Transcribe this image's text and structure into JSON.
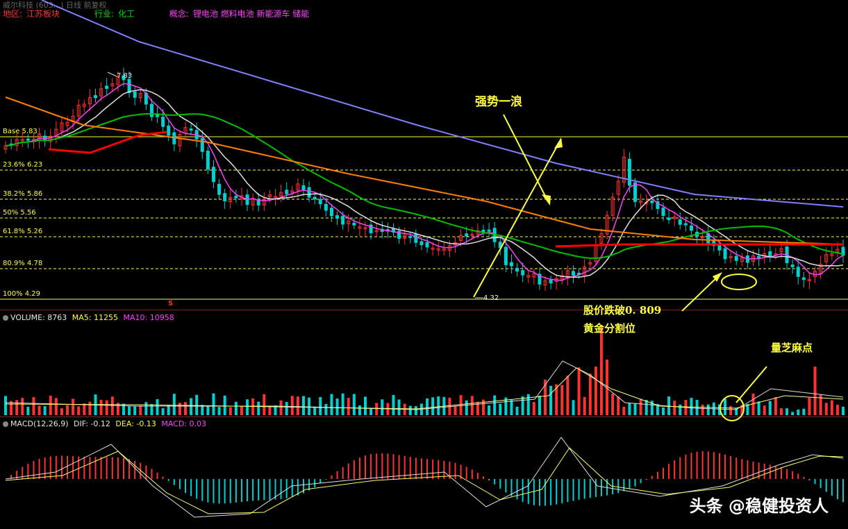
{
  "header": {
    "row1": "威尔科技 (603...) 日线 前复权",
    "region_label": "地区:",
    "region_value": "江苏板块",
    "industry_label": "行业:",
    "industry_value": "化工",
    "concept_label": "概念:",
    "concept_value": "锂电池 燃料电池 新能源车 储能"
  },
  "fib_levels": [
    {
      "label": "Base 5.83",
      "price": 5.83
    },
    {
      "label": "23.6% 6.23",
      "price": 6.23
    },
    {
      "label": "38.2% 5.86",
      "price": 5.86
    },
    {
      "label": "50% 5.56",
      "price": 5.56
    },
    {
      "label": "61.8% 5.26",
      "price": 5.26
    },
    {
      "label": "80.9% 4.78",
      "price": 4.78
    },
    {
      "label": "100% 4.29",
      "price": 4.29
    }
  ],
  "price_marks": {
    "high": "7.83",
    "low": "4.32",
    "s_marker": "S"
  },
  "volume": {
    "label": "VOLUME: 8763",
    "ma5": "MA5: 11255",
    "ma10": "MA10: 10958"
  },
  "macd": {
    "label": "MACD(12,26,9)",
    "dif": "DIF: -0.12",
    "dea": "DEA: -0.13",
    "macd": "MACD: 0.03"
  },
  "annotations": {
    "wave": "强势一浪",
    "break_line1": "股价跌破0. 809",
    "break_line2": "黄金分割位",
    "volume_note": "量芝麻点"
  },
  "watermark": "头条 @稳健投资人",
  "colors": {
    "up": "#ff3232",
    "down": "#00d0d0",
    "fib": "#ffff40",
    "ma_blue": "#8080ff",
    "ma_orange": "#ff8000",
    "ma_green": "#00c000",
    "ma_red": "#ff0000",
    "ma_white": "#e0e0e0",
    "ma_magenta": "#ff40ff"
  }
}
